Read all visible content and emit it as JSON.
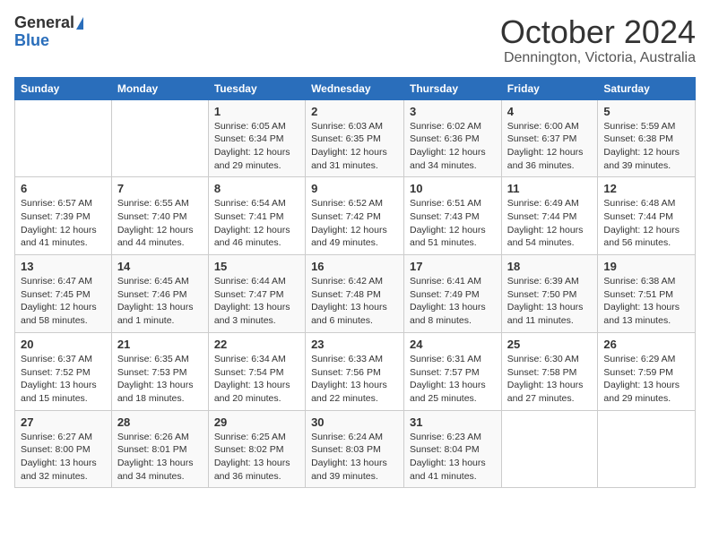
{
  "header": {
    "logo_general": "General",
    "logo_blue": "Blue",
    "title": "October 2024",
    "location": "Dennington, Victoria, Australia"
  },
  "days_of_week": [
    "Sunday",
    "Monday",
    "Tuesday",
    "Wednesday",
    "Thursday",
    "Friday",
    "Saturday"
  ],
  "weeks": [
    [
      {
        "day": "",
        "info": ""
      },
      {
        "day": "",
        "info": ""
      },
      {
        "day": "1",
        "info": "Sunrise: 6:05 AM\nSunset: 6:34 PM\nDaylight: 12 hours and 29 minutes."
      },
      {
        "day": "2",
        "info": "Sunrise: 6:03 AM\nSunset: 6:35 PM\nDaylight: 12 hours and 31 minutes."
      },
      {
        "day": "3",
        "info": "Sunrise: 6:02 AM\nSunset: 6:36 PM\nDaylight: 12 hours and 34 minutes."
      },
      {
        "day": "4",
        "info": "Sunrise: 6:00 AM\nSunset: 6:37 PM\nDaylight: 12 hours and 36 minutes."
      },
      {
        "day": "5",
        "info": "Sunrise: 5:59 AM\nSunset: 6:38 PM\nDaylight: 12 hours and 39 minutes."
      }
    ],
    [
      {
        "day": "6",
        "info": "Sunrise: 6:57 AM\nSunset: 7:39 PM\nDaylight: 12 hours and 41 minutes."
      },
      {
        "day": "7",
        "info": "Sunrise: 6:55 AM\nSunset: 7:40 PM\nDaylight: 12 hours and 44 minutes."
      },
      {
        "day": "8",
        "info": "Sunrise: 6:54 AM\nSunset: 7:41 PM\nDaylight: 12 hours and 46 minutes."
      },
      {
        "day": "9",
        "info": "Sunrise: 6:52 AM\nSunset: 7:42 PM\nDaylight: 12 hours and 49 minutes."
      },
      {
        "day": "10",
        "info": "Sunrise: 6:51 AM\nSunset: 7:43 PM\nDaylight: 12 hours and 51 minutes."
      },
      {
        "day": "11",
        "info": "Sunrise: 6:49 AM\nSunset: 7:44 PM\nDaylight: 12 hours and 54 minutes."
      },
      {
        "day": "12",
        "info": "Sunrise: 6:48 AM\nSunset: 7:44 PM\nDaylight: 12 hours and 56 minutes."
      }
    ],
    [
      {
        "day": "13",
        "info": "Sunrise: 6:47 AM\nSunset: 7:45 PM\nDaylight: 12 hours and 58 minutes."
      },
      {
        "day": "14",
        "info": "Sunrise: 6:45 AM\nSunset: 7:46 PM\nDaylight: 13 hours and 1 minute."
      },
      {
        "day": "15",
        "info": "Sunrise: 6:44 AM\nSunset: 7:47 PM\nDaylight: 13 hours and 3 minutes."
      },
      {
        "day": "16",
        "info": "Sunrise: 6:42 AM\nSunset: 7:48 PM\nDaylight: 13 hours and 6 minutes."
      },
      {
        "day": "17",
        "info": "Sunrise: 6:41 AM\nSunset: 7:49 PM\nDaylight: 13 hours and 8 minutes."
      },
      {
        "day": "18",
        "info": "Sunrise: 6:39 AM\nSunset: 7:50 PM\nDaylight: 13 hours and 11 minutes."
      },
      {
        "day": "19",
        "info": "Sunrise: 6:38 AM\nSunset: 7:51 PM\nDaylight: 13 hours and 13 minutes."
      }
    ],
    [
      {
        "day": "20",
        "info": "Sunrise: 6:37 AM\nSunset: 7:52 PM\nDaylight: 13 hours and 15 minutes."
      },
      {
        "day": "21",
        "info": "Sunrise: 6:35 AM\nSunset: 7:53 PM\nDaylight: 13 hours and 18 minutes."
      },
      {
        "day": "22",
        "info": "Sunrise: 6:34 AM\nSunset: 7:54 PM\nDaylight: 13 hours and 20 minutes."
      },
      {
        "day": "23",
        "info": "Sunrise: 6:33 AM\nSunset: 7:56 PM\nDaylight: 13 hours and 22 minutes."
      },
      {
        "day": "24",
        "info": "Sunrise: 6:31 AM\nSunset: 7:57 PM\nDaylight: 13 hours and 25 minutes."
      },
      {
        "day": "25",
        "info": "Sunrise: 6:30 AM\nSunset: 7:58 PM\nDaylight: 13 hours and 27 minutes."
      },
      {
        "day": "26",
        "info": "Sunrise: 6:29 AM\nSunset: 7:59 PM\nDaylight: 13 hours and 29 minutes."
      }
    ],
    [
      {
        "day": "27",
        "info": "Sunrise: 6:27 AM\nSunset: 8:00 PM\nDaylight: 13 hours and 32 minutes."
      },
      {
        "day": "28",
        "info": "Sunrise: 6:26 AM\nSunset: 8:01 PM\nDaylight: 13 hours and 34 minutes."
      },
      {
        "day": "29",
        "info": "Sunrise: 6:25 AM\nSunset: 8:02 PM\nDaylight: 13 hours and 36 minutes."
      },
      {
        "day": "30",
        "info": "Sunrise: 6:24 AM\nSunset: 8:03 PM\nDaylight: 13 hours and 39 minutes."
      },
      {
        "day": "31",
        "info": "Sunrise: 6:23 AM\nSunset: 8:04 PM\nDaylight: 13 hours and 41 minutes."
      },
      {
        "day": "",
        "info": ""
      },
      {
        "day": "",
        "info": ""
      }
    ]
  ]
}
